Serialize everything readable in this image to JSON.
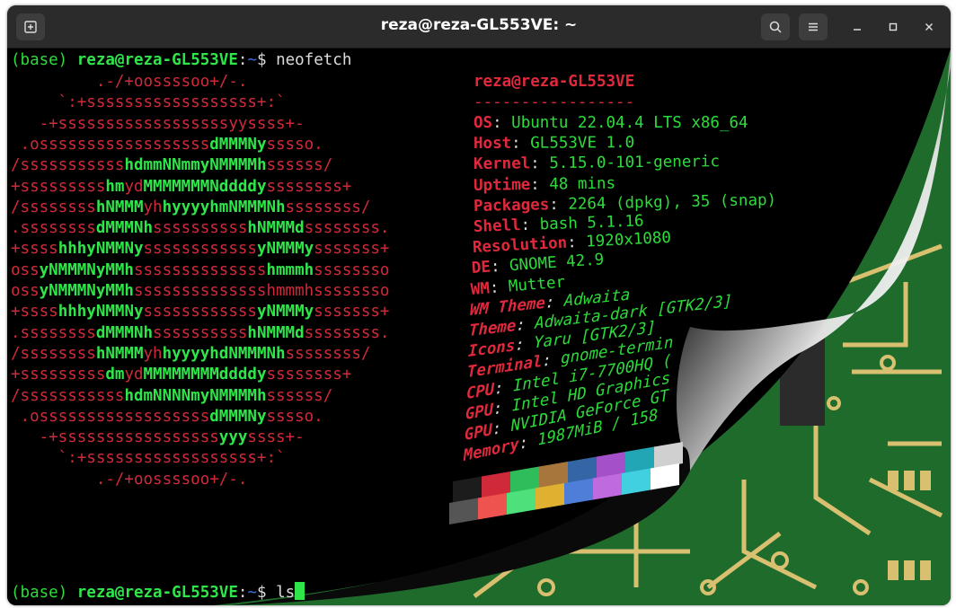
{
  "window": {
    "title": "reza@reza-GL553VE: ~"
  },
  "colors": {
    "terminal_bg": "#000000",
    "prompt_green": "#2ddc3b",
    "path_blue": "#3b6fe0",
    "logo_red": "#d02a3a",
    "pcb_green": "#1e6b2c",
    "pcb_trace": "#d9c071"
  },
  "terminal": {
    "prompt1": {
      "env": "(base) ",
      "user_host": "reza@reza-GL553VE",
      "sep": ":",
      "path": "~",
      "dollar": "$ ",
      "command": "neofetch"
    },
    "prompt2": {
      "env": "(base) ",
      "user_host": "reza@reza-GL553VE",
      "sep": ":",
      "path": "~",
      "dollar": "$ ",
      "command": "ls"
    }
  },
  "logo": [
    [
      [
        "r",
        "         .-/+oossssoo+/-.           "
      ]
    ],
    [
      [
        "r",
        "     `:+ssssssssssssssssss+:`       "
      ]
    ],
    [
      [
        "r",
        "   -+ssssssssssssssssssyyssss+-     "
      ]
    ],
    [
      [
        "r",
        " .ossssssssssssssssss"
      ],
      [
        "gb",
        "dMMMNy"
      ],
      [
        "r",
        "sssso.   "
      ]
    ],
    [
      [
        "r",
        "/sssssssssss"
      ],
      [
        "gb",
        "hdmmNNmmyNMMMMh"
      ],
      [
        "r",
        "ssssss/  "
      ]
    ],
    [
      [
        "r",
        "+sssssssss"
      ],
      [
        "gb",
        "hm"
      ],
      [
        "r",
        "yd"
      ],
      [
        "gb",
        "MMMMMMMNddddy"
      ],
      [
        "r",
        "ssssssss+ "
      ]
    ],
    [
      [
        "r",
        "/ssssssss"
      ],
      [
        "gb",
        "hNMMM"
      ],
      [
        "r",
        "yh"
      ],
      [
        "gb",
        "hyyyyhmNMMMNh"
      ],
      [
        "r",
        "ssssssss/ "
      ]
    ],
    [
      [
        "r",
        ".ssssssss"
      ],
      [
        "gb",
        "dMMMNh"
      ],
      [
        "r",
        "ssssssssss"
      ],
      [
        "gb",
        "hNMMMd"
      ],
      [
        "r",
        "ssssssss."
      ]
    ],
    [
      [
        "r",
        "+ssss"
      ],
      [
        "gb",
        "hhhyNMMNy"
      ],
      [
        "r",
        "ssssssssssss"
      ],
      [
        "gb",
        "yNMMMy"
      ],
      [
        "r",
        "sssssss+"
      ]
    ],
    [
      [
        "r",
        "oss"
      ],
      [
        "gb",
        "yNMMMNyMMh"
      ],
      [
        "r",
        "ssssssssssssss"
      ],
      [
        "gb",
        "hmmmh"
      ],
      [
        "r",
        "ssssssso"
      ]
    ],
    [
      [
        "r",
        "oss"
      ],
      [
        "gb",
        "yNMMMNyMMh"
      ],
      [
        "r",
        "sssssssssssssshmmmhssssssso"
      ]
    ],
    [
      [
        "r",
        "+ssss"
      ],
      [
        "gb",
        "hhhyNMMNy"
      ],
      [
        "r",
        "ssssssssssss"
      ],
      [
        "gb",
        "yNMMMy"
      ],
      [
        "r",
        "sssssss+"
      ]
    ],
    [
      [
        "r",
        ".ssssssss"
      ],
      [
        "gb",
        "dMMMNh"
      ],
      [
        "r",
        "ssssssssss"
      ],
      [
        "gb",
        "hNMMMd"
      ],
      [
        "r",
        "ssssssss."
      ]
    ],
    [
      [
        "r",
        "/ssssssss"
      ],
      [
        "gb",
        "hNMMM"
      ],
      [
        "r",
        "yh"
      ],
      [
        "gb",
        "hyyyyhdNMMMNh"
      ],
      [
        "r",
        "ssssssss/ "
      ]
    ],
    [
      [
        "r",
        "+sssssssss"
      ],
      [
        "gb",
        "dm"
      ],
      [
        "r",
        "yd"
      ],
      [
        "gb",
        "MMMMMMMMddddy"
      ],
      [
        "r",
        "ssssssss+ "
      ]
    ],
    [
      [
        "r",
        "/sssssssssss"
      ],
      [
        "gb",
        "hdmNNNNmyNMMMMh"
      ],
      [
        "r",
        "ssssss/  "
      ]
    ],
    [
      [
        "r",
        " .ossssssssssssssssss"
      ],
      [
        "gb",
        "dMMMNy"
      ],
      [
        "r",
        "sssso.   "
      ]
    ],
    [
      [
        "r",
        "   -+sssssssssssssssss"
      ],
      [
        "gb",
        "yyy"
      ],
      [
        "r",
        "ssss+-     "
      ]
    ],
    [
      [
        "r",
        "     `:+ssssssssssssssssss+:`       "
      ]
    ],
    [
      [
        "r",
        "         .-/+oossssoo+/-.           "
      ]
    ]
  ],
  "info": {
    "header": "reza@reza-GL553VE",
    "divider": "-----------------",
    "rows": [
      {
        "key": "OS",
        "value": "Ubuntu 22.04.4 LTS x86_64"
      },
      {
        "key": "Host",
        "value": "GL553VE 1.0"
      },
      {
        "key": "Kernel",
        "value": "5.15.0-101-generic"
      },
      {
        "key": "Uptime",
        "value": "48 mins"
      },
      {
        "key": "Packages",
        "value": "2264 (dpkg), 35 (snap)"
      },
      {
        "key": "Shell",
        "value": "bash 5.1.16"
      },
      {
        "key": "Resolution",
        "value": "1920x1080"
      },
      {
        "key": "DE",
        "value": "GNOME 42.9"
      },
      {
        "key": "WM",
        "value": "Mutter"
      },
      {
        "key": "WM Theme",
        "value": "Adwaita"
      },
      {
        "key": "Theme",
        "value": "Adwaita-dark [GTK2/3]"
      },
      {
        "key": "Icons",
        "value": "Yaru [GTK2/3]"
      },
      {
        "key": "Terminal",
        "value": "gnome-termin"
      },
      {
        "key": "CPU",
        "value": "Intel i7-7700HQ ("
      },
      {
        "key": "GPU",
        "value": "Intel HD Graphics"
      },
      {
        "key": "GPU",
        "value": "NVIDIA GeForce GT"
      },
      {
        "key": "Memory",
        "value": "1987MiB / 158"
      }
    ],
    "palette_top": [
      "#1c1c1c",
      "#d02a3a",
      "#2ebd5a",
      "#a6763c",
      "#3465a4",
      "#a450c8",
      "#22a5b5",
      "#d0d0d0"
    ],
    "palette_bottom": [
      "#555555",
      "#ef5350",
      "#4ee07a",
      "#e0b030",
      "#4f7ed8",
      "#c06ae0",
      "#40d0e0",
      "#ffffff"
    ]
  },
  "icons": {
    "new_tab": "new-tab-icon",
    "search": "search-icon",
    "menu": "hamburger-menu-icon",
    "minimize": "minimize-icon",
    "maximize": "maximize-icon",
    "close": "close-icon"
  }
}
